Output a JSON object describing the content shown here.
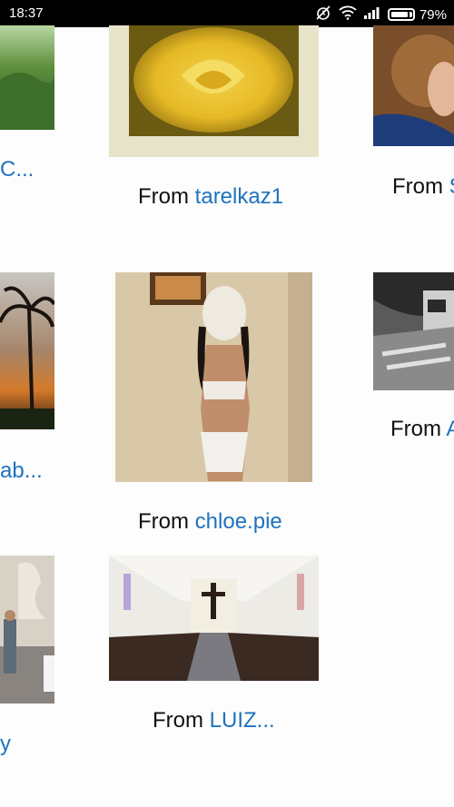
{
  "status_bar": {
    "time": "18:37",
    "icons": [
      "alarm-off-icon",
      "wifi-icon",
      "signal-icon",
      "battery-icon"
    ],
    "battery": "79%"
  },
  "grid": {
    "from_label": "From",
    "left_col": [
      {
        "text": "C..."
      },
      {
        "text": "ab..."
      },
      {
        "text": "y"
      }
    ],
    "middle_col": [
      {
        "user": "tarelkaz1",
        "thumb": "yellow-rose-photo"
      },
      {
        "user": "chloe.pie",
        "thumb": "woman-in-lingerie-photo"
      },
      {
        "user": "LUIZ...",
        "thumb": "church-interior-photo"
      }
    ],
    "right_col": [
      {
        "user": "S",
        "thumb": "curly-hair-woman-photo"
      },
      {
        "user": "A",
        "thumb": "bw-ruins-photo"
      }
    ]
  },
  "colors": {
    "link": "#1e73be",
    "text": "#111111",
    "status_bar": "#000000"
  }
}
